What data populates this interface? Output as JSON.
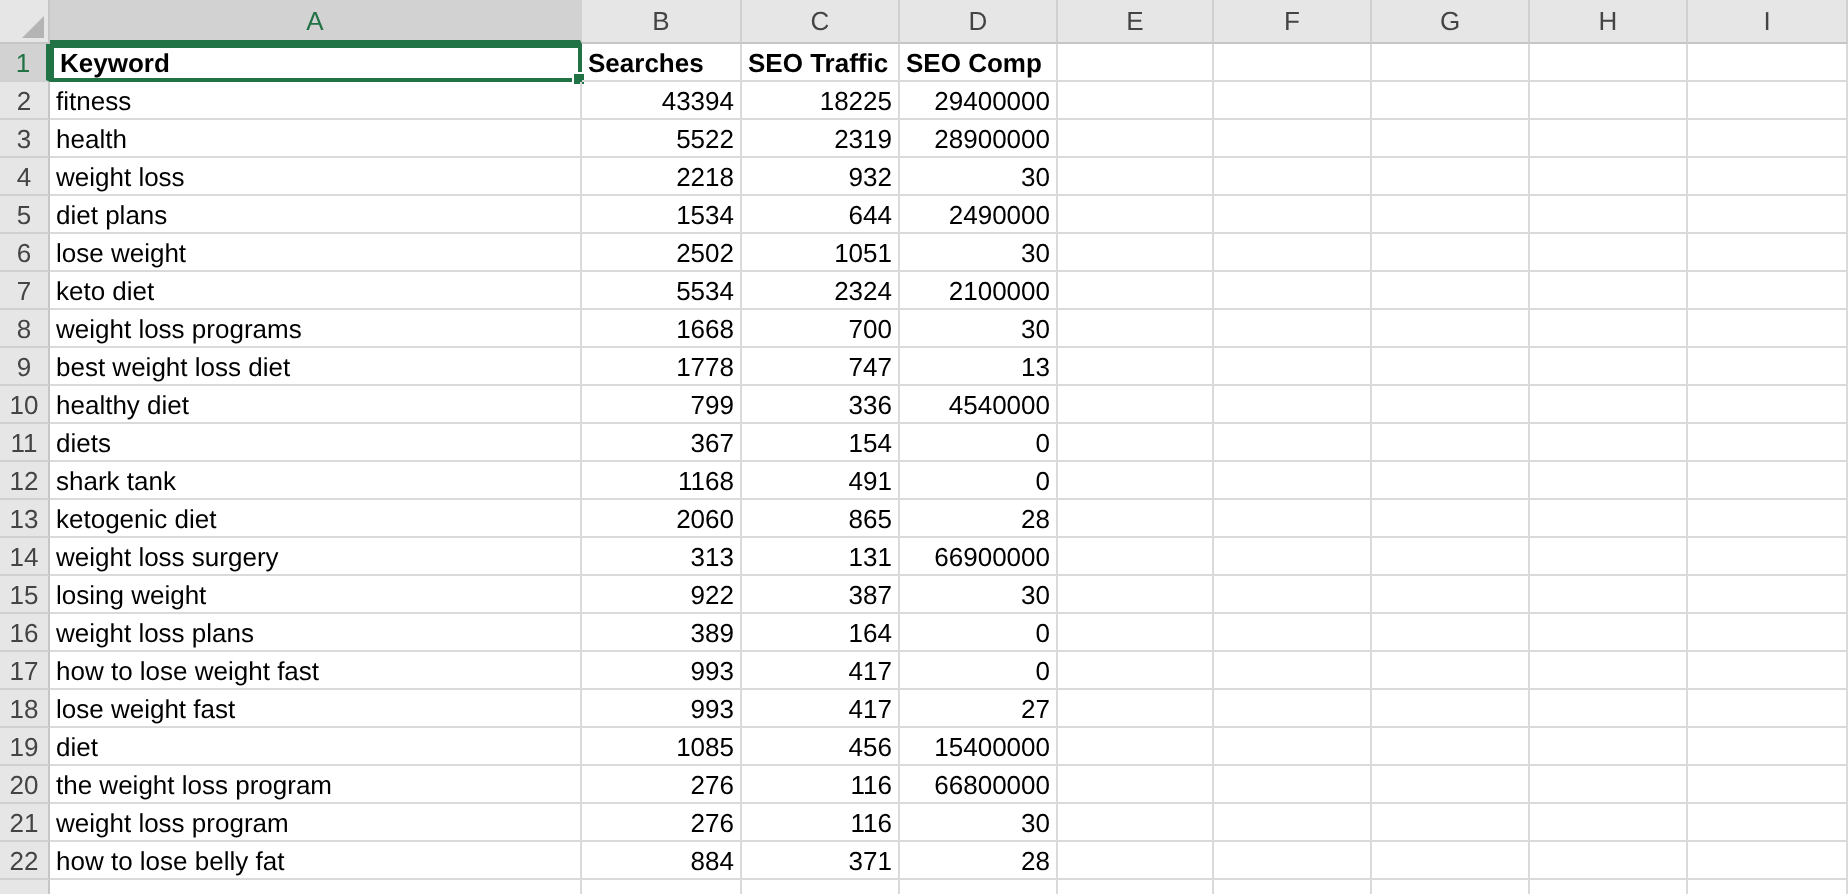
{
  "sheet": {
    "columns": [
      {
        "label": "A",
        "selected": true
      },
      {
        "label": "B",
        "selected": false
      },
      {
        "label": "C",
        "selected": false
      },
      {
        "label": "D",
        "selected": false
      },
      {
        "label": "E",
        "selected": false
      },
      {
        "label": "F",
        "selected": false
      },
      {
        "label": "G",
        "selected": false
      },
      {
        "label": "H",
        "selected": false
      },
      {
        "label": "I",
        "selected": false
      }
    ],
    "rows": [
      {
        "header": "1",
        "selected": true,
        "bold": true,
        "cells": [
          {
            "text": "Keyword",
            "kind": "text",
            "selected": true
          },
          {
            "text": "Searches",
            "kind": "text",
            "selected": false
          },
          {
            "text": "SEO Traffic",
            "kind": "text",
            "selected": false
          },
          {
            "text": "SEO Comp",
            "kind": "text",
            "selected": false
          }
        ]
      },
      {
        "header": "2",
        "selected": false,
        "bold": false,
        "cells": [
          {
            "text": "fitness",
            "kind": "text",
            "selected": false
          },
          {
            "text": "43394",
            "kind": "number",
            "selected": false
          },
          {
            "text": "18225",
            "kind": "number",
            "selected": false
          },
          {
            "text": "29400000",
            "kind": "number",
            "selected": false
          }
        ]
      },
      {
        "header": "3",
        "selected": false,
        "bold": false,
        "cells": [
          {
            "text": "health",
            "kind": "text",
            "selected": false
          },
          {
            "text": "5522",
            "kind": "number",
            "selected": false
          },
          {
            "text": "2319",
            "kind": "number",
            "selected": false
          },
          {
            "text": "28900000",
            "kind": "number",
            "selected": false
          }
        ]
      },
      {
        "header": "4",
        "selected": false,
        "bold": false,
        "cells": [
          {
            "text": "weight loss",
            "kind": "text",
            "selected": false
          },
          {
            "text": "2218",
            "kind": "number",
            "selected": false
          },
          {
            "text": "932",
            "kind": "number",
            "selected": false
          },
          {
            "text": "30",
            "kind": "number",
            "selected": false
          }
        ]
      },
      {
        "header": "5",
        "selected": false,
        "bold": false,
        "cells": [
          {
            "text": "diet plans",
            "kind": "text",
            "selected": false
          },
          {
            "text": "1534",
            "kind": "number",
            "selected": false
          },
          {
            "text": "644",
            "kind": "number",
            "selected": false
          },
          {
            "text": "2490000",
            "kind": "number",
            "selected": false
          }
        ]
      },
      {
        "header": "6",
        "selected": false,
        "bold": false,
        "cells": [
          {
            "text": "lose weight",
            "kind": "text",
            "selected": false
          },
          {
            "text": "2502",
            "kind": "number",
            "selected": false
          },
          {
            "text": "1051",
            "kind": "number",
            "selected": false
          },
          {
            "text": "30",
            "kind": "number",
            "selected": false
          }
        ]
      },
      {
        "header": "7",
        "selected": false,
        "bold": false,
        "cells": [
          {
            "text": "keto diet",
            "kind": "text",
            "selected": false
          },
          {
            "text": "5534",
            "kind": "number",
            "selected": false
          },
          {
            "text": "2324",
            "kind": "number",
            "selected": false
          },
          {
            "text": "2100000",
            "kind": "number",
            "selected": false
          }
        ]
      },
      {
        "header": "8",
        "selected": false,
        "bold": false,
        "cells": [
          {
            "text": "weight loss programs",
            "kind": "text",
            "selected": false
          },
          {
            "text": "1668",
            "kind": "number",
            "selected": false
          },
          {
            "text": "700",
            "kind": "number",
            "selected": false
          },
          {
            "text": "30",
            "kind": "number",
            "selected": false
          }
        ]
      },
      {
        "header": "9",
        "selected": false,
        "bold": false,
        "cells": [
          {
            "text": "best weight loss diet",
            "kind": "text",
            "selected": false
          },
          {
            "text": "1778",
            "kind": "number",
            "selected": false
          },
          {
            "text": "747",
            "kind": "number",
            "selected": false
          },
          {
            "text": "13",
            "kind": "number",
            "selected": false
          }
        ]
      },
      {
        "header": "10",
        "selected": false,
        "bold": false,
        "cells": [
          {
            "text": "healthy diet",
            "kind": "text",
            "selected": false
          },
          {
            "text": "799",
            "kind": "number",
            "selected": false
          },
          {
            "text": "336",
            "kind": "number",
            "selected": false
          },
          {
            "text": "4540000",
            "kind": "number",
            "selected": false
          }
        ]
      },
      {
        "header": "11",
        "selected": false,
        "bold": false,
        "cells": [
          {
            "text": "diets",
            "kind": "text",
            "selected": false
          },
          {
            "text": "367",
            "kind": "number",
            "selected": false
          },
          {
            "text": "154",
            "kind": "number",
            "selected": false
          },
          {
            "text": "0",
            "kind": "number",
            "selected": false
          }
        ]
      },
      {
        "header": "12",
        "selected": false,
        "bold": false,
        "cells": [
          {
            "text": "shark tank",
            "kind": "text",
            "selected": false
          },
          {
            "text": "1168",
            "kind": "number",
            "selected": false
          },
          {
            "text": "491",
            "kind": "number",
            "selected": false
          },
          {
            "text": "0",
            "kind": "number",
            "selected": false
          }
        ]
      },
      {
        "header": "13",
        "selected": false,
        "bold": false,
        "cells": [
          {
            "text": "ketogenic diet",
            "kind": "text",
            "selected": false
          },
          {
            "text": "2060",
            "kind": "number",
            "selected": false
          },
          {
            "text": "865",
            "kind": "number",
            "selected": false
          },
          {
            "text": "28",
            "kind": "number",
            "selected": false
          }
        ]
      },
      {
        "header": "14",
        "selected": false,
        "bold": false,
        "cells": [
          {
            "text": "weight loss surgery",
            "kind": "text",
            "selected": false
          },
          {
            "text": "313",
            "kind": "number",
            "selected": false
          },
          {
            "text": "131",
            "kind": "number",
            "selected": false
          },
          {
            "text": "66900000",
            "kind": "number",
            "selected": false
          }
        ]
      },
      {
        "header": "15",
        "selected": false,
        "bold": false,
        "cells": [
          {
            "text": "losing weight",
            "kind": "text",
            "selected": false
          },
          {
            "text": "922",
            "kind": "number",
            "selected": false
          },
          {
            "text": "387",
            "kind": "number",
            "selected": false
          },
          {
            "text": "30",
            "kind": "number",
            "selected": false
          }
        ]
      },
      {
        "header": "16",
        "selected": false,
        "bold": false,
        "cells": [
          {
            "text": "weight loss plans",
            "kind": "text",
            "selected": false
          },
          {
            "text": "389",
            "kind": "number",
            "selected": false
          },
          {
            "text": "164",
            "kind": "number",
            "selected": false
          },
          {
            "text": "0",
            "kind": "number",
            "selected": false
          }
        ]
      },
      {
        "header": "17",
        "selected": false,
        "bold": false,
        "cells": [
          {
            "text": "how to lose weight fast",
            "kind": "text",
            "selected": false
          },
          {
            "text": "993",
            "kind": "number",
            "selected": false
          },
          {
            "text": "417",
            "kind": "number",
            "selected": false
          },
          {
            "text": "0",
            "kind": "number",
            "selected": false
          }
        ]
      },
      {
        "header": "18",
        "selected": false,
        "bold": false,
        "cells": [
          {
            "text": "lose weight fast",
            "kind": "text",
            "selected": false
          },
          {
            "text": "993",
            "kind": "number",
            "selected": false
          },
          {
            "text": "417",
            "kind": "number",
            "selected": false
          },
          {
            "text": "27",
            "kind": "number",
            "selected": false
          }
        ]
      },
      {
        "header": "19",
        "selected": false,
        "bold": false,
        "cells": [
          {
            "text": "diet",
            "kind": "text",
            "selected": false
          },
          {
            "text": "1085",
            "kind": "number",
            "selected": false
          },
          {
            "text": "456",
            "kind": "number",
            "selected": false
          },
          {
            "text": "15400000",
            "kind": "number",
            "selected": false
          }
        ]
      },
      {
        "header": "20",
        "selected": false,
        "bold": false,
        "cells": [
          {
            "text": "the weight loss program",
            "kind": "text",
            "selected": false
          },
          {
            "text": "276",
            "kind": "number",
            "selected": false
          },
          {
            "text": "116",
            "kind": "number",
            "selected": false
          },
          {
            "text": "66800000",
            "kind": "number",
            "selected": false
          }
        ]
      },
      {
        "header": "21",
        "selected": false,
        "bold": false,
        "cells": [
          {
            "text": "weight loss program",
            "kind": "text",
            "selected": false
          },
          {
            "text": "276",
            "kind": "number",
            "selected": false
          },
          {
            "text": "116",
            "kind": "number",
            "selected": false
          },
          {
            "text": "30",
            "kind": "number",
            "selected": false
          }
        ]
      },
      {
        "header": "22",
        "selected": false,
        "bold": false,
        "cells": [
          {
            "text": "how to lose belly fat",
            "kind": "text",
            "selected": false
          },
          {
            "text": "884",
            "kind": "number",
            "selected": false
          },
          {
            "text": "371",
            "kind": "number",
            "selected": false
          },
          {
            "text": "28",
            "kind": "number",
            "selected": false
          }
        ]
      }
    ]
  }
}
